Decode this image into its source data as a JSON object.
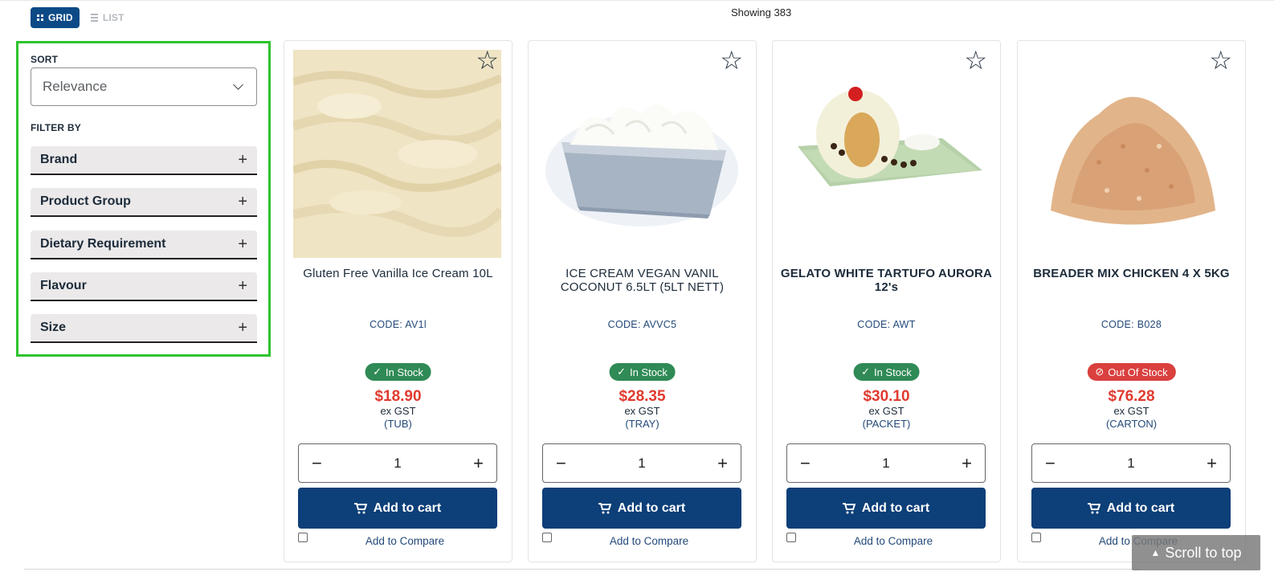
{
  "toolbar": {
    "grid_label": "GRID",
    "list_label": "LIST",
    "showing_text": "Showing 383"
  },
  "sidebar": {
    "sort_label": "SORT",
    "sort_value": "Relevance",
    "filter_label": "FILTER BY",
    "filters": [
      {
        "label": "Brand"
      },
      {
        "label": "Product Group"
      },
      {
        "label": "Dietary Requirement"
      },
      {
        "label": "Flavour"
      },
      {
        "label": "Size"
      }
    ]
  },
  "products": [
    {
      "name": "Gluten Free Vanilla Ice Cream 10L",
      "code": "CODE: AV1l",
      "stock": "In Stock",
      "price": "$18.90",
      "gst": "ex GST",
      "unit": "(TUB)",
      "qty": "1",
      "cart_label": "Add to cart",
      "compare_label": "Add to Compare"
    },
    {
      "name": "ICE CREAM VEGAN VANIL COCONUT 6.5LT (5LT NETT)",
      "code": "CODE: AVVC5",
      "stock": "In Stock",
      "price": "$28.35",
      "gst": "ex GST",
      "unit": "(TRAY)",
      "qty": "1",
      "cart_label": "Add to cart",
      "compare_label": "Add to Compare"
    },
    {
      "name": "GELATO WHITE TARTUFO AURORA 12's",
      "code": "CODE: AWT",
      "stock": "In Stock",
      "price": "$30.10",
      "gst": "ex GST",
      "unit": "(PACKET)",
      "qty": "1",
      "cart_label": "Add to cart",
      "compare_label": "Add to Compare"
    },
    {
      "name": "BREADER MIX CHICKEN 4 X 5KG",
      "code": "CODE: B028",
      "stock": "Out Of Stock",
      "price": "$76.28",
      "gst": "ex GST",
      "unit": "(CARTON)",
      "qty": "1",
      "cart_label": "Add to cart",
      "compare_label": "Add to Compare"
    }
  ],
  "scroll_top_label": "Scroll to top",
  "colors": {
    "brand_navy": "#0d3f78",
    "in_stock": "#2f8a55",
    "out_of_stock": "#d9403e",
    "price": "#e03a2f",
    "sidebar_highlight": "#2ec42e"
  },
  "icons": [
    "grid-icon",
    "list-icon",
    "chevron-down-icon",
    "plus-icon",
    "star-icon",
    "check-icon",
    "ban-icon",
    "minus-icon",
    "cart-icon",
    "arrow-up-icon"
  ]
}
